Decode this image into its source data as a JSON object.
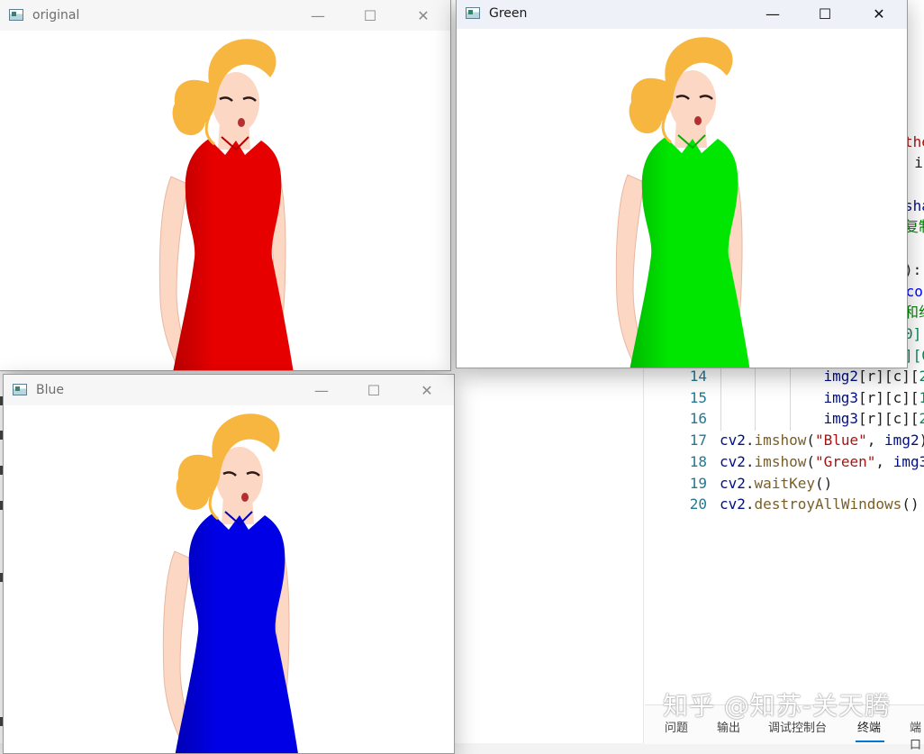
{
  "editor": {
    "lines": [
      {
        "num": "14",
        "indent": 3,
        "code": "img2[r][c][2"
      },
      {
        "num": "15",
        "indent": 3,
        "code": "img3[r][c][1"
      },
      {
        "num": "16",
        "indent": 3,
        "code": "img3[r][c][2"
      },
      {
        "num": "17",
        "indent": 0,
        "code": "cv2.imshow(\"Blue\", img2)"
      },
      {
        "num": "18",
        "indent": 0,
        "code": "cv2.imshow(\"Green\", img3"
      },
      {
        "num": "19",
        "indent": 0,
        "code": "cv2.waitKey()"
      },
      {
        "num": "20",
        "indent": 0,
        "code": "cv2.destroyAllWindows()"
      }
    ],
    "fragments": [
      {
        "text": "the",
        "color": "#a31515"
      },
      {
        "text": ", i",
        "color": "#1f1f1f"
      },
      {
        "text": "sha",
        "color": "#001080"
      },
      {
        "text": "复制",
        "color": "#008000"
      },
      {
        "text": "):",
        "color": "#1f1f1f"
      },
      {
        "text": " co",
        "color": "#0000ff"
      },
      {
        "text": "和组",
        "color": "#008000"
      },
      {
        "text": "0]",
        "color": "#098658"
      },
      {
        "text": "][0",
        "color": "#098658"
      }
    ],
    "panel_tabs": [
      "问题",
      "输出",
      "调试控制台",
      "终端",
      "端口"
    ],
    "active_tab": "终端",
    "watermark": "知乎 @知苏-关天腾"
  },
  "windows": [
    {
      "id": "original",
      "title": "original",
      "dress_color": "#e60000",
      "dress_shadow": "#b20000",
      "active": false
    },
    {
      "id": "green",
      "title": "Green",
      "dress_color": "#00e600",
      "dress_shadow": "#00b300",
      "active": true
    },
    {
      "id": "blue",
      "title": "Blue",
      "dress_color": "#0000e6",
      "dress_shadow": "#0000b0",
      "active": false
    }
  ],
  "controls": {
    "minimize_icon": "minimize-icon",
    "maximize_icon": "maximize-icon",
    "close_icon": "close-icon"
  },
  "colors": {
    "hair": "#f7b63f",
    "skin": "#fbd7c4",
    "skin_shadow": "#e9b7a0"
  }
}
